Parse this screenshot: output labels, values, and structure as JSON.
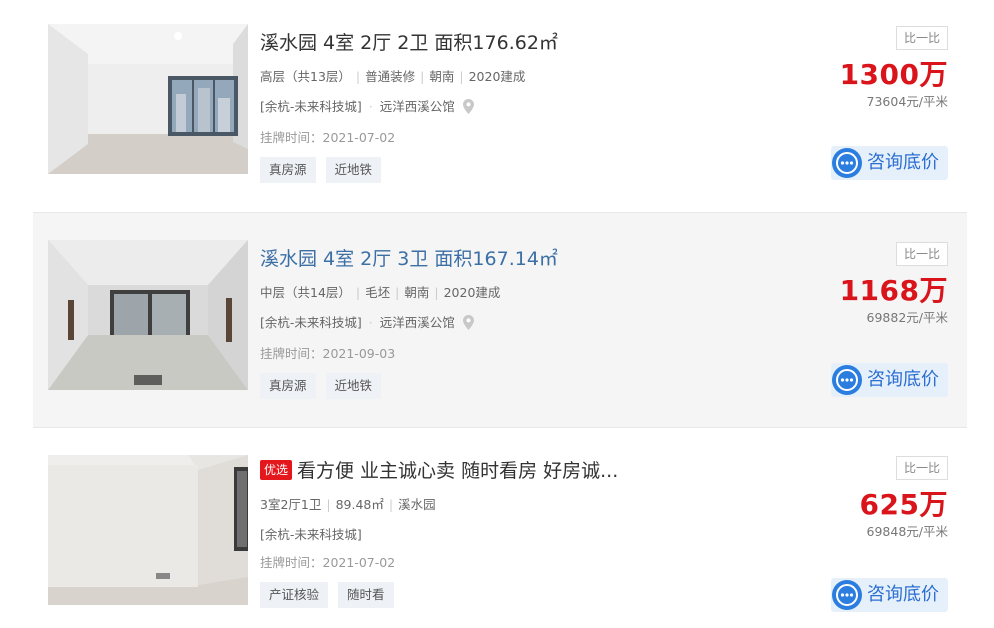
{
  "listings": [
    {
      "badge": "",
      "title": "溪水园 4室 2厅 2卫 面积176.62㎡",
      "attrs": [
        "高层（共13层）",
        "普通装修",
        "朝南",
        "2020建成"
      ],
      "district": "[余杭-未来科技城]",
      "community": "远洋西溪公馆",
      "listed": "挂牌时间：2021-07-02",
      "tags": [
        "真房源",
        "近地铁"
      ],
      "compare": "比一比",
      "price": "1300万",
      "unit_price": "73604元/平米",
      "consult": "咨询底价"
    },
    {
      "badge": "",
      "title": "溪水园 4室 2厅 3卫 面积167.14㎡",
      "attrs": [
        "中层（共14层）",
        "毛坯",
        "朝南",
        "2020建成"
      ],
      "district": "[余杭-未来科技城]",
      "community": "远洋西溪公馆",
      "listed": "挂牌时间：2021-09-03",
      "tags": [
        "真房源",
        "近地铁"
      ],
      "compare": "比一比",
      "price": "1168万",
      "unit_price": "69882元/平米",
      "consult": "咨询底价"
    },
    {
      "badge": "优选",
      "title": "看方便 业主诚心卖 随时看房 好房诚...",
      "attrs": [
        "3室2厅1卫",
        "89.48㎡",
        "溪水园"
      ],
      "district": "[余杭-未来科技城]",
      "community": "",
      "listed": "挂牌时间：2021-07-02",
      "tags": [
        "产证核验",
        "随时看"
      ],
      "compare": "比一比",
      "price": "625万",
      "unit_price": "69848元/平米",
      "consult": "咨询底价"
    }
  ],
  "colors": {
    "price": "#d9141a",
    "link": "#3b6fa6",
    "consult_text": "#2b6fd1",
    "consult_bg": "#e6f0fb",
    "badge": "#e4171c"
  }
}
